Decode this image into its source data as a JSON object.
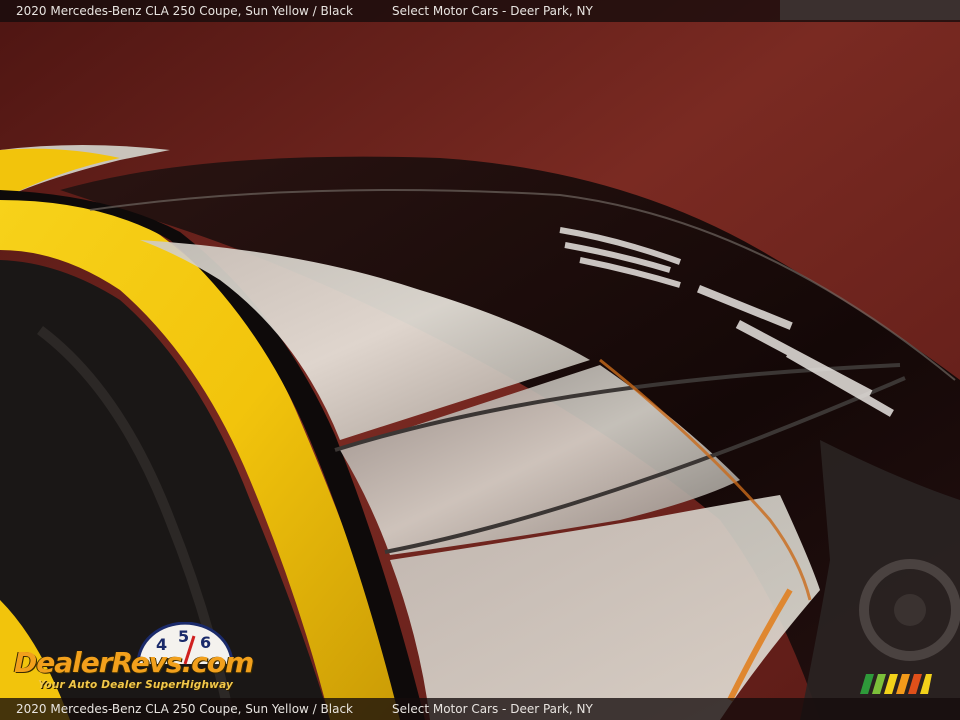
{
  "caption": {
    "title": "2020 Mercedes-Benz CLA 250 Coupe,  Sun Yellow / Black",
    "dealer": "Select Motor Cars - Deer Park, NY"
  },
  "watermark": {
    "brand": "DealerRevs.com",
    "tagline": "Your Auto Dealer SuperHighway",
    "speedometer_digits": [
      "4",
      "5",
      "6"
    ]
  },
  "colors": {
    "body_paint": "#f2c40c",
    "roof_glass": "#1a0c0a",
    "wall": "#6b1f1a",
    "caption_bg": "#140c0c",
    "logo_orange": "#f2a01c"
  }
}
